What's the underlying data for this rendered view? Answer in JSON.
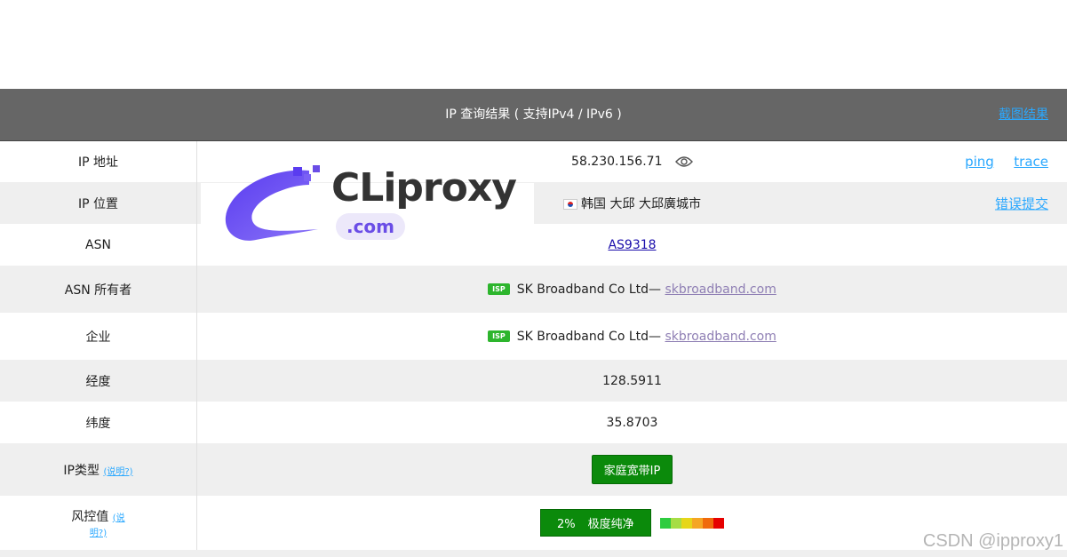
{
  "header": {
    "title": "IP 查询结果 ( 支持IPv4 / IPv6 )",
    "screenshot_link": "截图结果"
  },
  "rows": {
    "ip": {
      "label": "IP 地址",
      "value": "58.230.156.71",
      "icon": "eye-icon",
      "links": [
        "ping",
        "trace"
      ]
    },
    "location": {
      "label": "IP 位置",
      "value": "韩国 大邱 大邱廣城市",
      "flag": "south-korea-flag",
      "link": "错误提交"
    },
    "asn": {
      "label": "ASN",
      "value": "AS9318"
    },
    "asn_owner": {
      "label": "ASN 所有者",
      "badge": "ISP",
      "value": "SK Broadband Co Ltd—",
      "domain": "skbroadband.com"
    },
    "enterprise": {
      "label": "企业",
      "badge": "ISP",
      "value": "SK Broadband Co Ltd—",
      "domain": "skbroadband.com"
    },
    "longitude": {
      "label": "经度",
      "value": "128.5911"
    },
    "latitude": {
      "label": "纬度",
      "value": "35.8703"
    },
    "ip_type": {
      "label": "IP类型",
      "explain": "(说明?)",
      "value": "家庭宽带IP"
    },
    "risk": {
      "label": "风控值",
      "explain_1": "(说",
      "explain_2": "明?)",
      "percent": "2%",
      "value": "极度纯净",
      "level_fraction": 0.02,
      "scale_colors": [
        "#2ecc40",
        "#a6dd45",
        "#e6d619",
        "#f5a623",
        "#f06a0c",
        "#e60000"
      ]
    }
  },
  "overlay": {
    "logo_text": "CLiproxy",
    "logo_sub": ".com",
    "watermark": "CSDN @ipproxy1"
  },
  "colors": {
    "header_bg": "#666666",
    "link": "#2aa8ff",
    "badge_green": "#0b8a0b",
    "isp_green": "#2db52d",
    "logo_purple": "#6a4de6"
  }
}
